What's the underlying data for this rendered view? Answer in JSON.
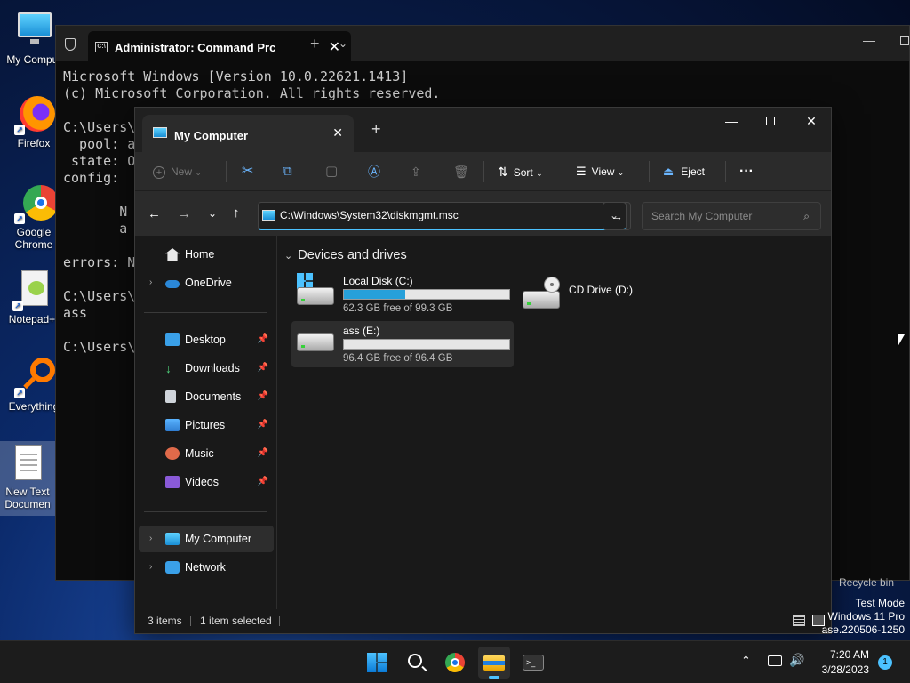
{
  "desktop": {
    "icons": [
      {
        "label": "My Comput",
        "icon": "computer-icon"
      },
      {
        "label": "Firefox",
        "icon": "firefox-icon"
      },
      {
        "label": "Google Chrome",
        "icon": "chrome-icon"
      },
      {
        "label": "Notepad+",
        "icon": "notepad-plus-icon"
      },
      {
        "label": "Everything",
        "icon": "everything-icon"
      },
      {
        "label": "New Text Documen",
        "icon": "text-document-icon"
      }
    ],
    "recycle_bin_label": "Recycle bin",
    "watermark": [
      "Test Mode",
      "Windows 11 Pro",
      "ase.220506-1250"
    ]
  },
  "cmd": {
    "tab_title": "Administrator: Command Prc",
    "lines": [
      "Microsoft Windows [Version 10.0.22621.1413]",
      "(c) Microsoft Corporation. All rights reserved.",
      "",
      "C:\\Users\\",
      "  pool: a",
      " state: O",
      "config:",
      "",
      "       N",
      "       a",
      "",
      "errors: N",
      "",
      "C:\\Users\\",
      "ass",
      "",
      "C:\\Users\\"
    ]
  },
  "explorer": {
    "tab_title": "My Computer",
    "toolbar": {
      "new": "New",
      "sort": "Sort",
      "view": "View",
      "eject": "Eject",
      "more": "···"
    },
    "address": "C:\\Windows\\System32\\diskmgmt.msc",
    "search_placeholder": "Search My Computer",
    "nav": {
      "home": "Home",
      "onedrive": "OneDrive",
      "pinned": [
        "Desktop",
        "Downloads",
        "Documents",
        "Pictures",
        "Music",
        "Videos"
      ],
      "my_computer": "My Computer",
      "network": "Network"
    },
    "section_title": "Devices and drives",
    "drives": [
      {
        "name": "Local Disk (C:)",
        "free": "62.3 GB free of 99.3 GB",
        "used_fraction": 0.373
      },
      {
        "name": "CD Drive (D:)"
      },
      {
        "name": "ass (E:)",
        "free": "96.4 GB free of 96.4 GB",
        "used_fraction": 0.0
      }
    ],
    "status": {
      "items": "3 items",
      "selected": "1 item selected"
    }
  },
  "taskbar": {
    "time": "7:20 AM",
    "date": "3/28/2023",
    "notification_count": "1",
    "apps": [
      "start-icon",
      "search-icon",
      "chrome-icon",
      "file-explorer-icon",
      "terminal-icon"
    ]
  }
}
